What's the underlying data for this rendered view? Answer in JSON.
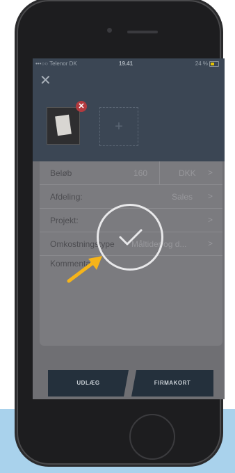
{
  "status_bar": {
    "carrier": "•••○○ Telenor DK",
    "time": "19.41",
    "battery": "24 %"
  },
  "header": {
    "close_icon": "close-icon",
    "add_photo": "+"
  },
  "form": {
    "amount": {
      "label": "Beløb",
      "value": "160",
      "currency": "DKK"
    },
    "department": {
      "label": "Afdeling:",
      "value": "Sales"
    },
    "project": {
      "label": "Projekt:",
      "value": ""
    },
    "expense_type": {
      "label": "Omkostningstype",
      "value": "Måltider og d..."
    },
    "comment_label": "Kommentar"
  },
  "buttons": {
    "udlaeg": "UDLÆG",
    "firmakort": "FIRMAKORT"
  },
  "colors": {
    "header_bg": "#3b4654",
    "accent_arrow": "#f5b41a",
    "button_bg": "#24303c",
    "badge": "#b23a3f"
  }
}
